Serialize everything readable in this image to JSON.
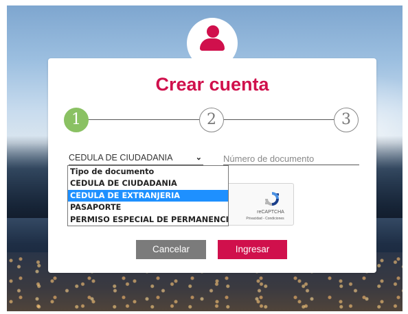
{
  "form": {
    "title": "Crear cuenta",
    "steps": [
      "1",
      "2",
      "3"
    ],
    "active_step": 1,
    "document_type": {
      "selected_display": "CEDULA DE CIUDADANIA",
      "highlighted_option": "CEDULA DE EXTRANJERIA",
      "options": [
        "Tipo de documento",
        "CEDULA DE CIUDADANIA",
        "CEDULA DE EXTRANJERIA",
        "PASAPORTE",
        "PERMISO ESPECIAL DE PERMANENCIA"
      ]
    },
    "document_number": {
      "placeholder": "Número de documento",
      "value": ""
    },
    "recaptcha": {
      "label": "reCAPTCHA",
      "links": "Privacidad - Condiciones"
    },
    "buttons": {
      "cancel": "Cancelar",
      "submit": "Ingresar"
    }
  },
  "colors": {
    "brand": "#d0104c",
    "step_active": "#8ac163",
    "cancel_button": "#7b7b7b",
    "dropdown_highlight": "#1e90ff"
  },
  "icons": {
    "avatar": "user-icon",
    "select_arrow": "chevron-down-icon",
    "captcha": "recaptcha-logo-icon"
  }
}
